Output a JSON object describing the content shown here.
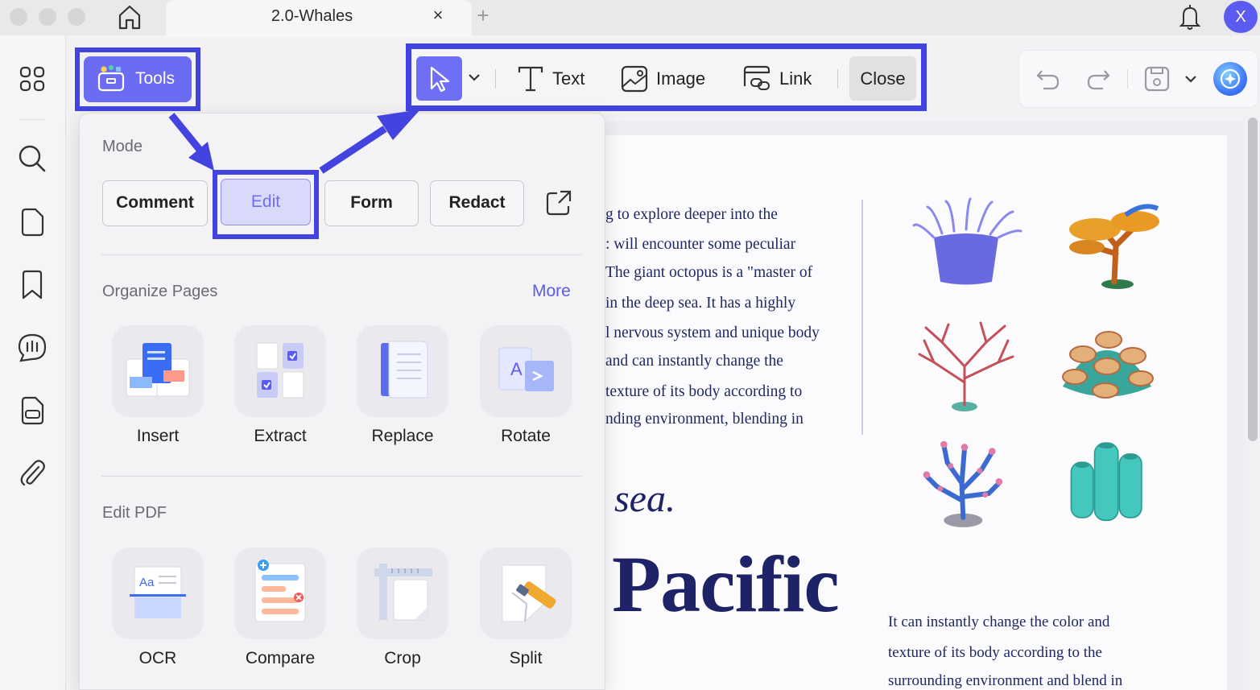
{
  "window": {
    "tab_title": "2.0-Whales",
    "tab_close": "×",
    "tab_add": "+",
    "user_initial": "X"
  },
  "sidebar": {
    "icons": [
      "grid-icon",
      "search-icon",
      "page-icon",
      "bookmark-icon",
      "comment-icon",
      "form-icon",
      "attachment-icon"
    ]
  },
  "tools_button": {
    "label": "Tools"
  },
  "edit_toolbar": {
    "text_label": "Text",
    "image_label": "Image",
    "link_label": "Link",
    "close_label": "Close"
  },
  "tools_panel": {
    "mode_title": "Mode",
    "modes": [
      "Comment",
      "Edit",
      "Form",
      "Redact"
    ],
    "organize_title": "Organize Pages",
    "more_label": "More",
    "organize_items": [
      "Insert",
      "Extract",
      "Replace",
      "Rotate"
    ],
    "edit_pdf_title": "Edit PDF",
    "edit_pdf_items": [
      "OCR",
      "Compare",
      "Crop",
      "Split"
    ]
  },
  "document": {
    "body_lines": [
      "g to explore deeper into the",
      ": will encounter some peculiar",
      " The giant octopus is a \"master of",
      "in the deep sea. It has a highly",
      "l nervous system and unique body",
      "and can instantly change the",
      "texture of its body according to",
      "nding environment, blending in"
    ],
    "sea_word": "sea.",
    "pacific_word": "Pacific",
    "caption_lines": [
      "It can instantly change the color and",
      "texture of its body according to the",
      "surrounding environment and blend in"
    ]
  },
  "colors": {
    "accent": "#5b5bf0",
    "highlight_border": "#4343e0",
    "doc_text": "#1d2366"
  }
}
